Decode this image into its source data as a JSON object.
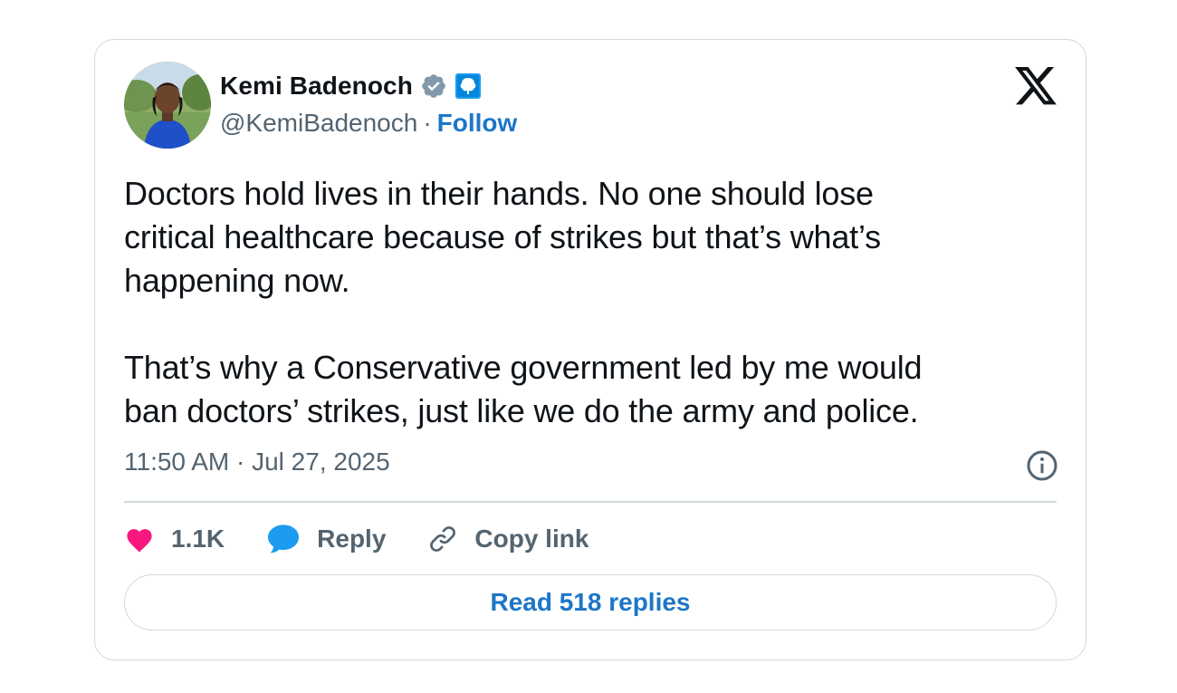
{
  "author": {
    "display_name": "Kemi Badenoch",
    "handle": "@KemiBadenoch",
    "separator": "·",
    "follow_label": "Follow",
    "verified_icon": "verified-badge-icon",
    "affiliation_icon": "conservative-party-tree-icon"
  },
  "tweet": {
    "text": "Doctors hold lives in their hands. No one should lose\ncritical healthcare because of strikes but that’s what’s\nhappening now.\n\nThat’s why a Conservative government led by me would\nban doctors’ strikes, just like we do the army and police.",
    "timestamp": "11:50 AM · Jul 27, 2025"
  },
  "actions": {
    "likes_count": "1.1K",
    "reply_label": "Reply",
    "copy_link_label": "Copy link"
  },
  "footer": {
    "read_replies_label": "Read 518 replies"
  },
  "colors": {
    "link_blue": "#1d76c8",
    "like_pink": "#f91880",
    "reply_blue": "#1d9bf0",
    "muted_gray": "#536471",
    "border": "#cfd9de"
  }
}
